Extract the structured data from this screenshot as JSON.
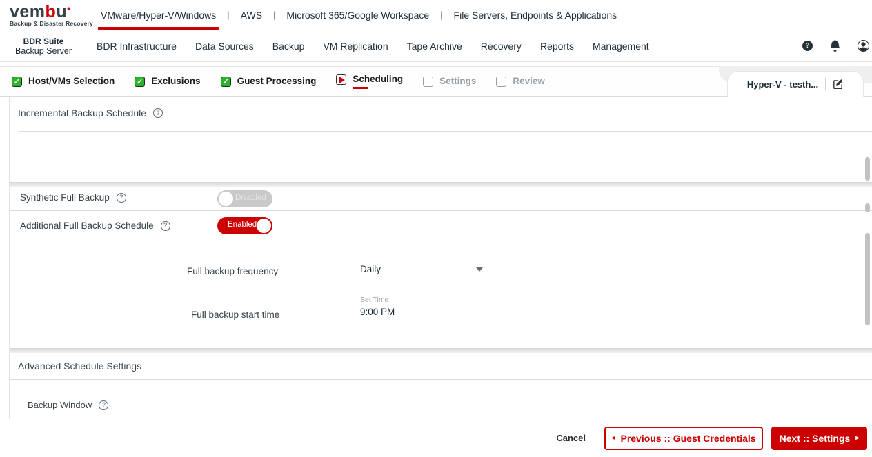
{
  "brand": {
    "logo_pre": "vem",
    "logo_accent": "b",
    "logo_post": "u",
    "logo_dot": "•",
    "tagline": "Backup & Disaster Recovery"
  },
  "product_nav": {
    "tabs": [
      {
        "label": "VMware/Hyper-V/Windows",
        "active": true
      },
      {
        "label": "AWS",
        "active": false
      },
      {
        "label": "Microsoft 365/Google Workspace",
        "active": false
      },
      {
        "label": "File Servers, Endpoints & Applications",
        "active": false
      }
    ],
    "separator": "|"
  },
  "app_nav": {
    "suite_name": "BDR Suite",
    "server_name": "Backup Server",
    "items": [
      "BDR Infrastructure",
      "Data Sources",
      "Backup",
      "VM Replication",
      "Tape Archive",
      "Recovery",
      "Reports",
      "Management"
    ]
  },
  "icons": {
    "help_glyph": "?",
    "check_glyph": "✓",
    "prev_arrow": "◂",
    "next_arrow": "▸"
  },
  "wizard": {
    "steps": [
      {
        "label": "Host/VMs Selection",
        "state": "completed"
      },
      {
        "label": "Exclusions",
        "state": "completed"
      },
      {
        "label": "Guest Processing",
        "state": "completed"
      },
      {
        "label": "Scheduling",
        "state": "active"
      },
      {
        "label": "Settings",
        "state": "pending"
      },
      {
        "label": "Review",
        "state": "pending"
      }
    ],
    "job_tab": {
      "name": "Hyper-V - testh..."
    }
  },
  "form": {
    "incremental_title": "Incremental Backup Schedule",
    "synthetic": {
      "label": "Synthetic Full Backup",
      "toggle_label": "Disabled",
      "state": "off"
    },
    "additional": {
      "label": "Additional Full Backup Schedule",
      "toggle_label": "Enabled",
      "state": "on"
    },
    "frequency": {
      "label": "Full backup frequency",
      "value": "Daily"
    },
    "start_time": {
      "label": "Full backup start time",
      "input_label": "Set Time",
      "value": "9:00 PM"
    },
    "advanced_title": "Advanced Schedule Settings",
    "backup_window_label": "Backup Window"
  },
  "footer": {
    "cancel_label": "Cancel",
    "previous_label": "Previous :: Guest Credentials",
    "next_label": "Next :: Settings"
  },
  "colors": {
    "accent_red": "#cc0000",
    "check_green": "#2db22d",
    "toggle_off_gray": "#c9c9c9"
  }
}
